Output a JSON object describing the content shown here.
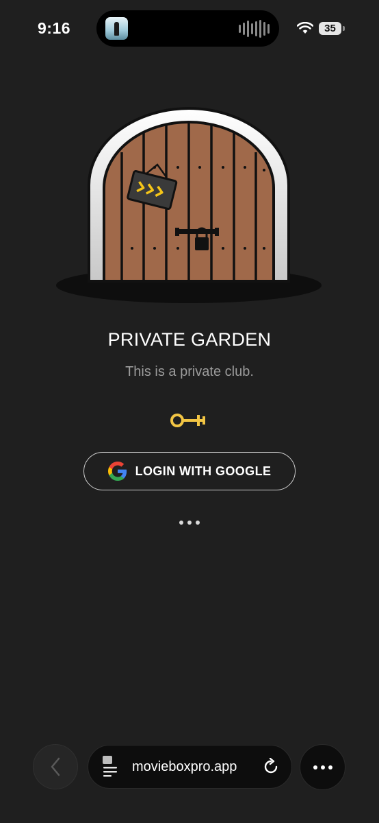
{
  "status_bar": {
    "time": "9:16",
    "battery": "35"
  },
  "page": {
    "title": "PRIVATE GARDEN",
    "subtitle": "This is a private club.",
    "login_button": "LOGIN WITH GOOGLE"
  },
  "browser": {
    "url": "movieboxpro.app"
  },
  "icons": {
    "door": "door-illustration",
    "key": "key-icon",
    "google": "google-logo-icon",
    "back": "chevron-left-icon",
    "page": "page-icon",
    "reload": "reload-icon",
    "more": "more-icon"
  },
  "colors": {
    "background": "#1f1f1f",
    "door_wood": "#a0694a",
    "door_frame": "#e8e8e8",
    "key_gold": "#f2c544",
    "sign_arrows": "#f5c518"
  }
}
